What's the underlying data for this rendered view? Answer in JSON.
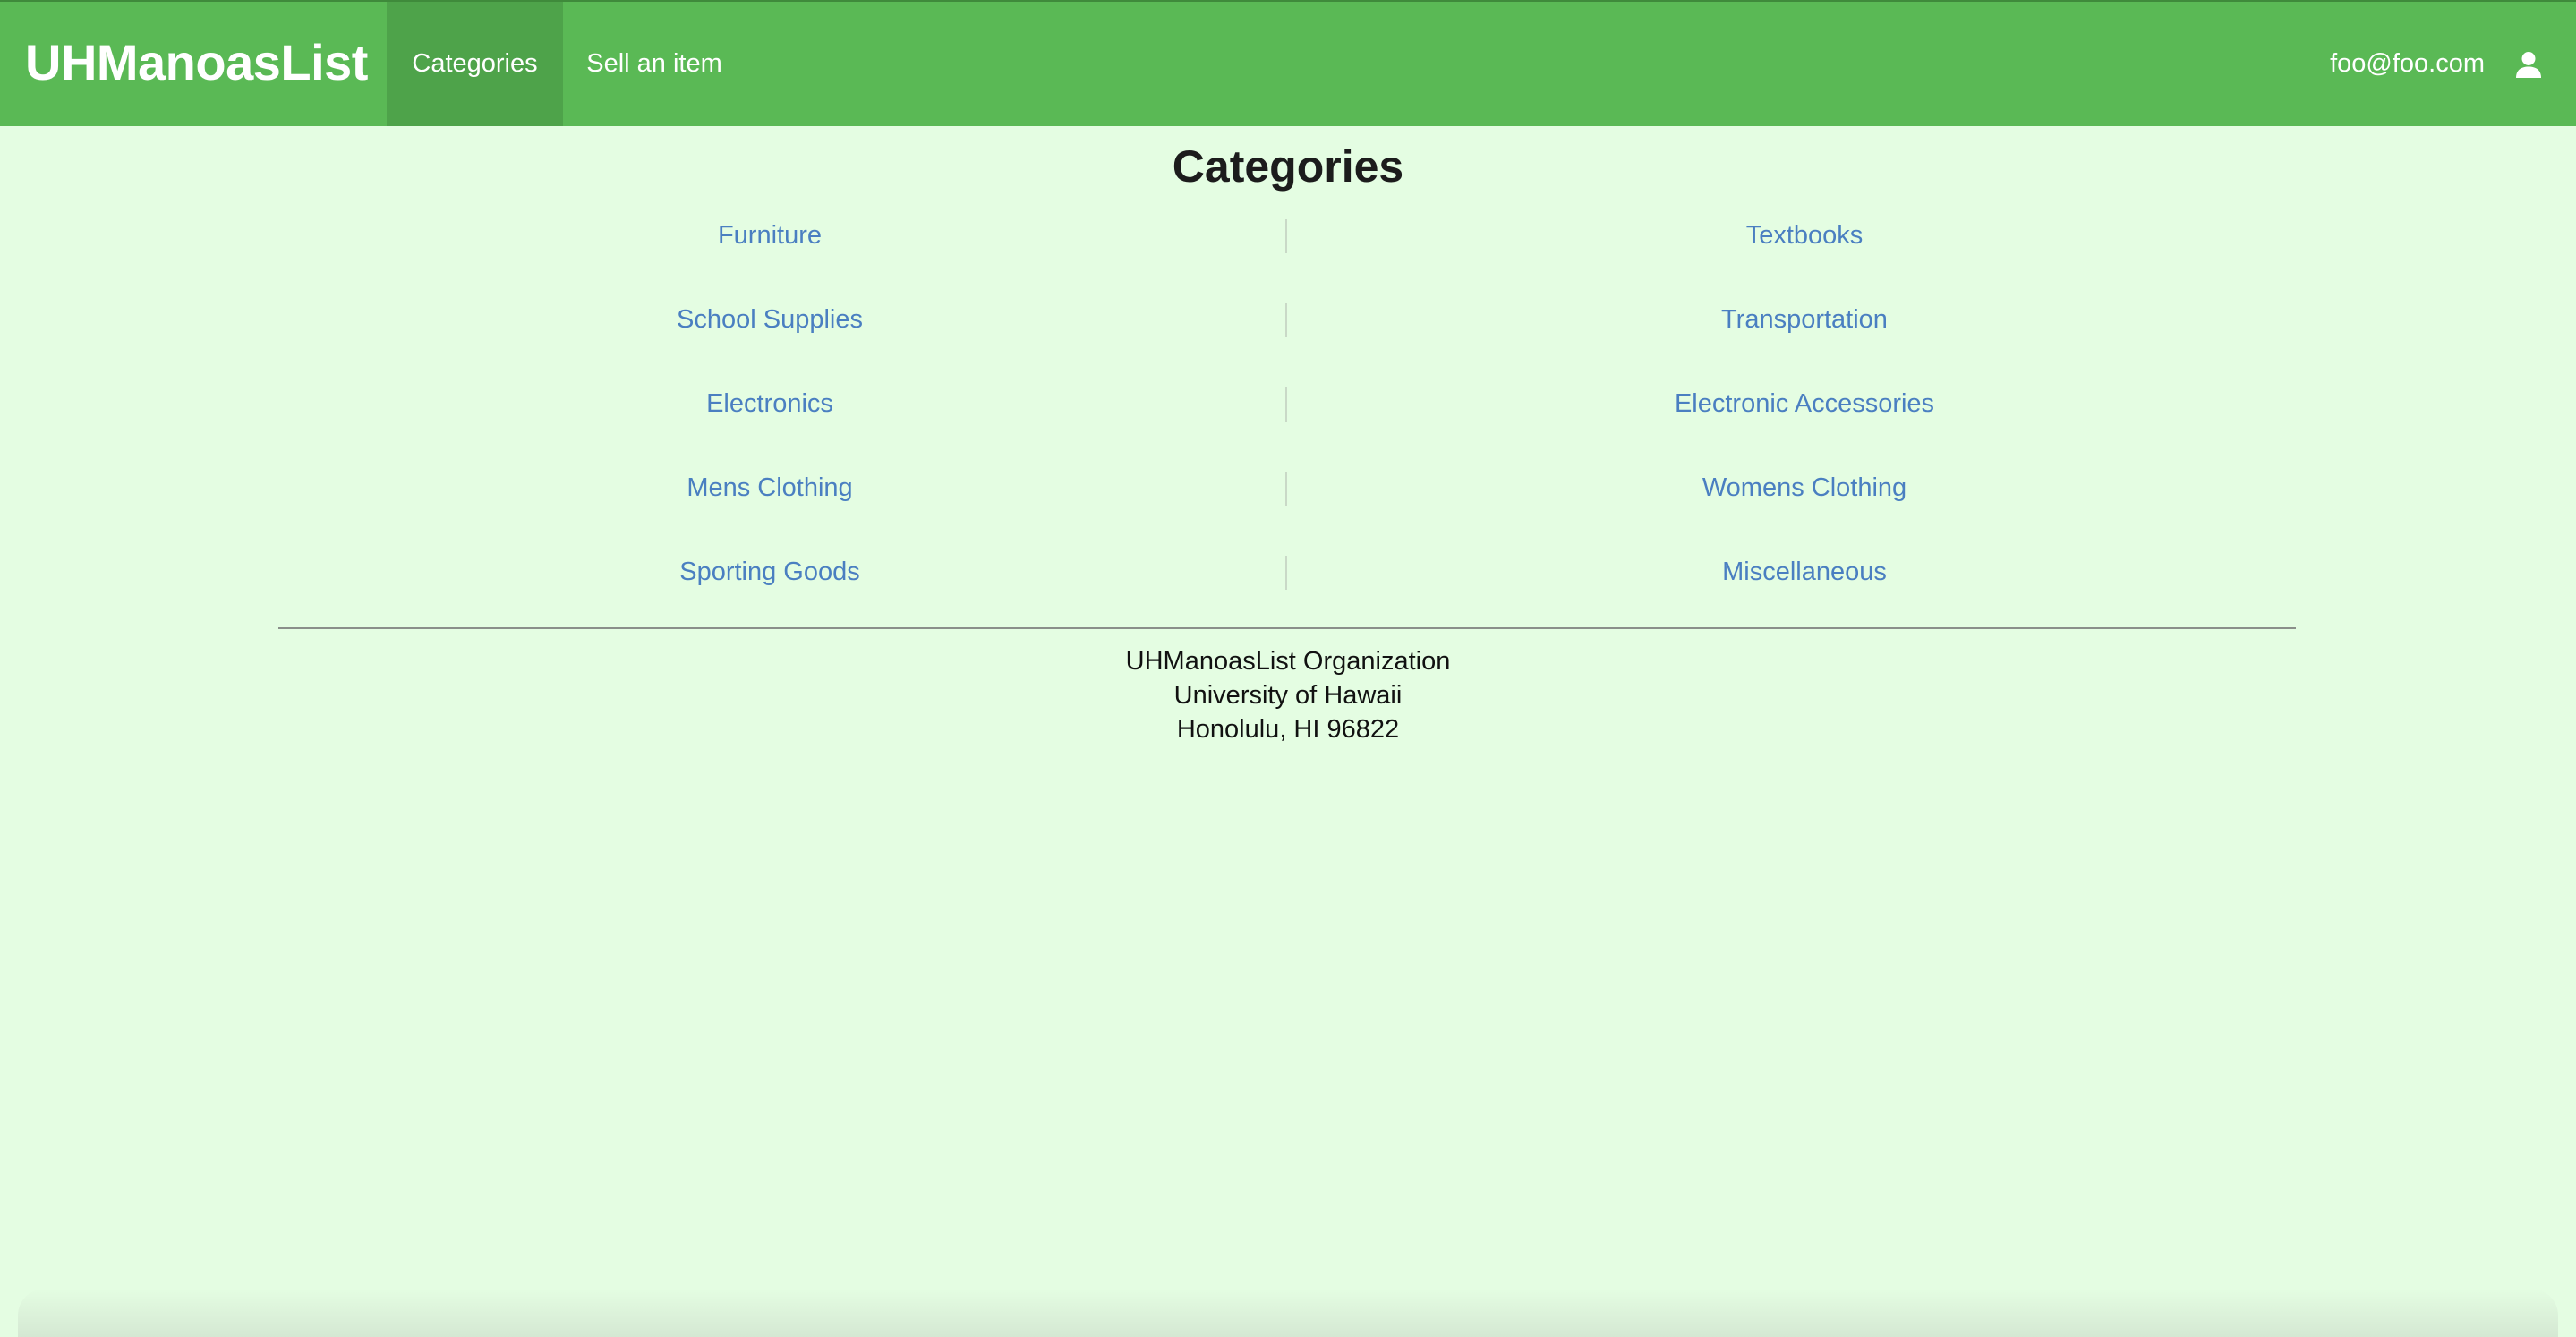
{
  "navbar": {
    "brand": "UHManoasList",
    "links": [
      {
        "label": "Categories",
        "active": true
      },
      {
        "label": "Sell an item",
        "active": false
      }
    ],
    "user_email": "foo@foo.com",
    "user_icon": "user-icon",
    "colors": {
      "background": "#5ab955",
      "active_tab": "#4ea34a",
      "text": "#ffffff"
    }
  },
  "main": {
    "title": "Categories",
    "categories_left": [
      "Furniture",
      "School Supplies",
      "Electronics",
      "Mens Clothing",
      "Sporting Goods"
    ],
    "categories_right": [
      "Textbooks",
      "Transportation",
      "Electronic Accessories",
      "Womens Clothing",
      "Miscellaneous"
    ],
    "link_color": "#4a7fc1",
    "background": "#e4fde2"
  },
  "footer": {
    "lines": [
      "UHManoasList Organization",
      "University of Hawaii",
      "Honolulu, HI 96822"
    ]
  }
}
